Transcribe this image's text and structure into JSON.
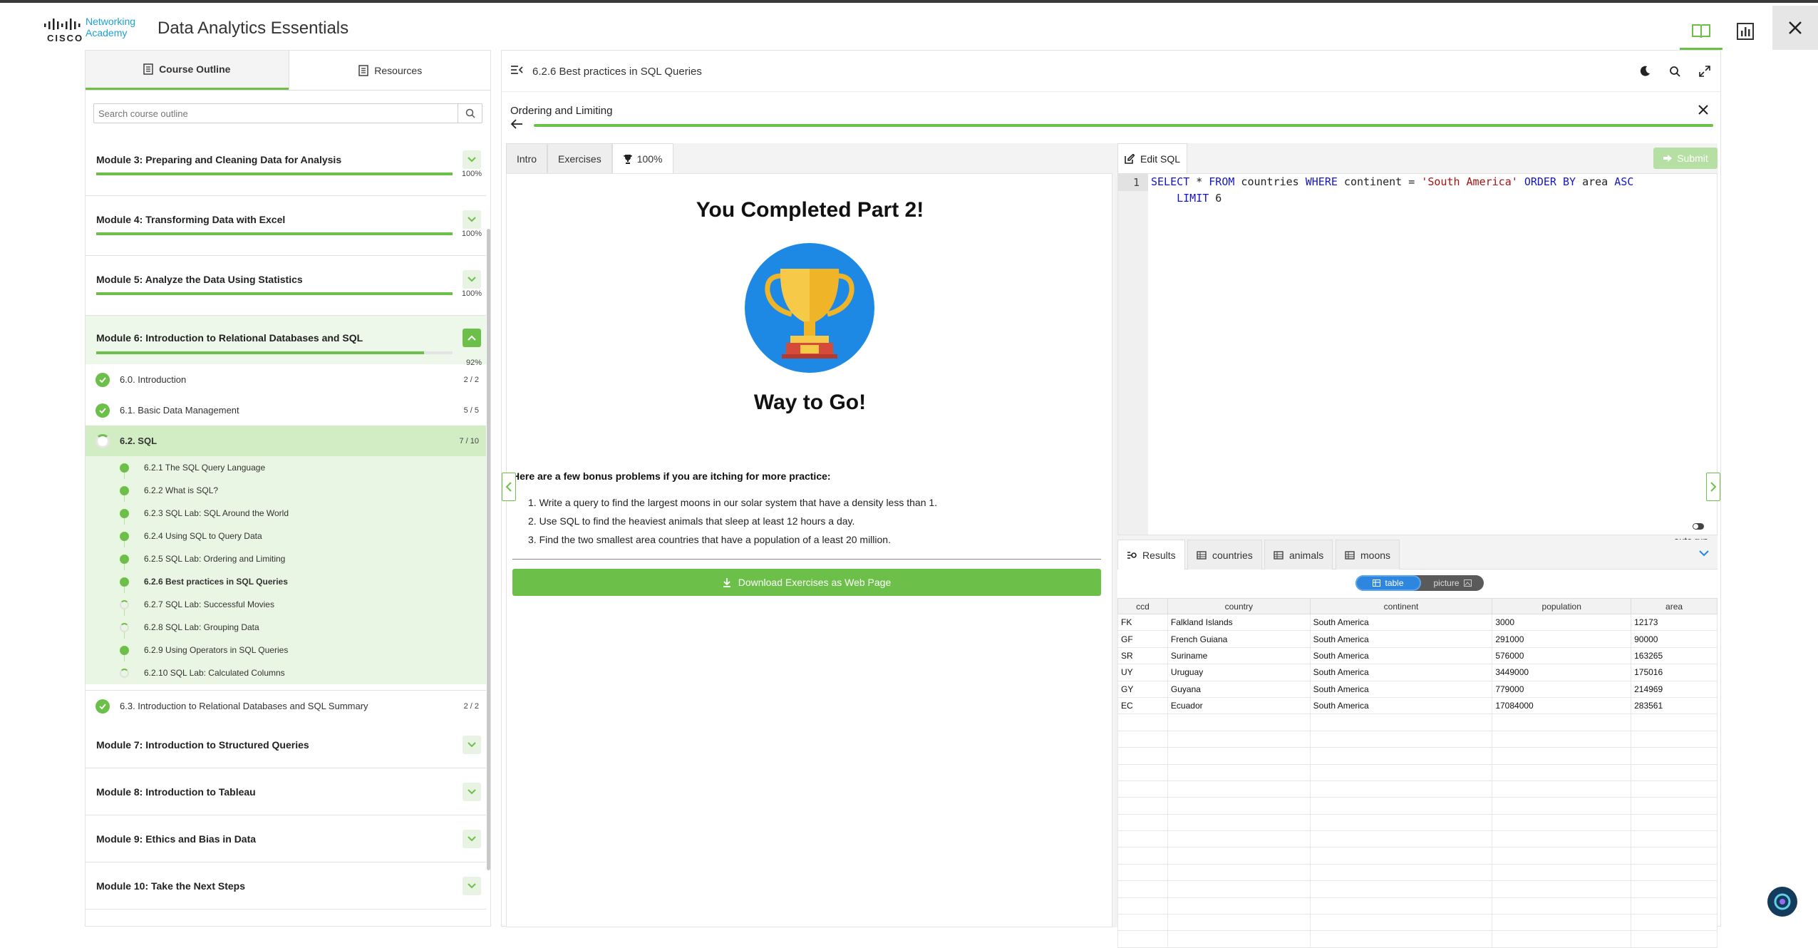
{
  "header": {
    "logo_top": "Networking",
    "logo_bottom": "Academy",
    "cisco": "CISCO",
    "title": "Data Analytics Essentials",
    "icons": [
      "book-icon",
      "chart-icon",
      "close-icon"
    ]
  },
  "sidebar": {
    "tabs": [
      {
        "label": "Course Outline",
        "icon": "document-icon"
      },
      {
        "label": "Resources",
        "icon": "document-icon"
      }
    ],
    "search_placeholder": "Search course outline",
    "modules": [
      {
        "title": "Module 3: Preparing and Cleaning Data for Analysis",
        "progress": 100,
        "pct": "100%"
      },
      {
        "title": "Module 4: Transforming Data with Excel",
        "progress": 100,
        "pct": "100%"
      },
      {
        "title": "Module 5: Analyze the Data Using Statistics",
        "progress": 100,
        "pct": "100%"
      },
      {
        "title": "Module 6: Introduction to Relational Databases and SQL",
        "progress": 92,
        "pct": "92%"
      }
    ],
    "sections": [
      {
        "title": "6.0. Introduction",
        "count": "2 / 2"
      },
      {
        "title": "6.1. Basic Data Management",
        "count": "5 / 5"
      },
      {
        "title": "6.2. SQL",
        "count": "7 / 10"
      }
    ],
    "subsections": [
      {
        "title": "6.2.1 The SQL Query Language",
        "done": true
      },
      {
        "title": "6.2.2 What is SQL?",
        "done": true
      },
      {
        "title": "6.2.3 SQL Lab: SQL Around the World",
        "done": true
      },
      {
        "title": "6.2.4 Using SQL to Query Data",
        "done": true
      },
      {
        "title": "6.2.5 SQL Lab: Ordering and Limiting",
        "done": true
      },
      {
        "title": "6.2.6 Best practices in SQL Queries",
        "done": true
      },
      {
        "title": "6.2.7 SQL Lab: Successful Movies",
        "done": false
      },
      {
        "title": "6.2.8 SQL Lab: Grouping Data",
        "done": false
      },
      {
        "title": "6.2.9 Using Operators in SQL Queries",
        "done": true
      },
      {
        "title": "6.2.10 SQL Lab: Calculated Columns",
        "done": false
      }
    ],
    "section_63": {
      "title": "6.3. Introduction to Relational Databases and SQL Summary",
      "count": "2 / 2"
    },
    "later_modules": [
      "Module 7: Introduction to Structured Queries",
      "Module 8: Introduction to Tableau",
      "Module 9: Ethics and Bias in Data",
      "Module 10: Take the Next Steps"
    ]
  },
  "main": {
    "page_title": "6.2.6 Best practices in SQL Queries",
    "lab_title": "Ordering and Limiting",
    "lab_progress": 100,
    "instr_tabs": [
      "Intro",
      "Exercises",
      "100%"
    ],
    "congrats": "You Completed Part 2!",
    "way_to_go": "Way to Go!",
    "bonus_title": "Here are a few bonus problems if you are itching for more practice:",
    "bonus": [
      "Write a query to find the largest moons in our solar system that have a density less than 1.",
      "Use SQL to find the heaviest animals that sleep at least 12 hours a day.",
      "Find the two smallest area countries that have a population of a least 20 million."
    ],
    "download_label": "Download Exercises as Web Page"
  },
  "editor": {
    "tab_label": "Edit SQL",
    "submit_label": "Submit",
    "line_number": "1",
    "code": {
      "k1": "SELECT",
      "t1": " * ",
      "k2": "FROM",
      "t2": " countries ",
      "k3": "WHERE",
      "t3": " continent = ",
      "s1": "'South America'",
      "t4": " ",
      "k4": "ORDER BY",
      "t5": " area ",
      "k5": "ASC",
      "t6": "\n    ",
      "k6": "LIMIT",
      "t7": " 6"
    },
    "autorun_label": "auto run"
  },
  "results": {
    "tabs": [
      "Results",
      "countries",
      "animals",
      "moons"
    ],
    "view_options": [
      "table",
      "picture"
    ],
    "columns": [
      "ccd",
      "country",
      "continent",
      "population",
      "area"
    ],
    "rows": [
      [
        "FK",
        "Falkland Islands",
        "South America",
        "3000",
        "12173"
      ],
      [
        "GF",
        "French Guiana",
        "South America",
        "291000",
        "90000"
      ],
      [
        "SR",
        "Suriname",
        "South America",
        "576000",
        "163265"
      ],
      [
        "UY",
        "Uruguay",
        "South America",
        "3449000",
        "175016"
      ],
      [
        "GY",
        "Guyana",
        "South America",
        "779000",
        "214969"
      ],
      [
        "EC",
        "Ecuador",
        "South America",
        "17084000",
        "283561"
      ]
    ]
  },
  "colors": {
    "accent": "#6cc04a",
    "link_blue": "#1ba0d7",
    "trophy_bg": "#1e88e5",
    "trophy_gold": "#f7c948"
  }
}
